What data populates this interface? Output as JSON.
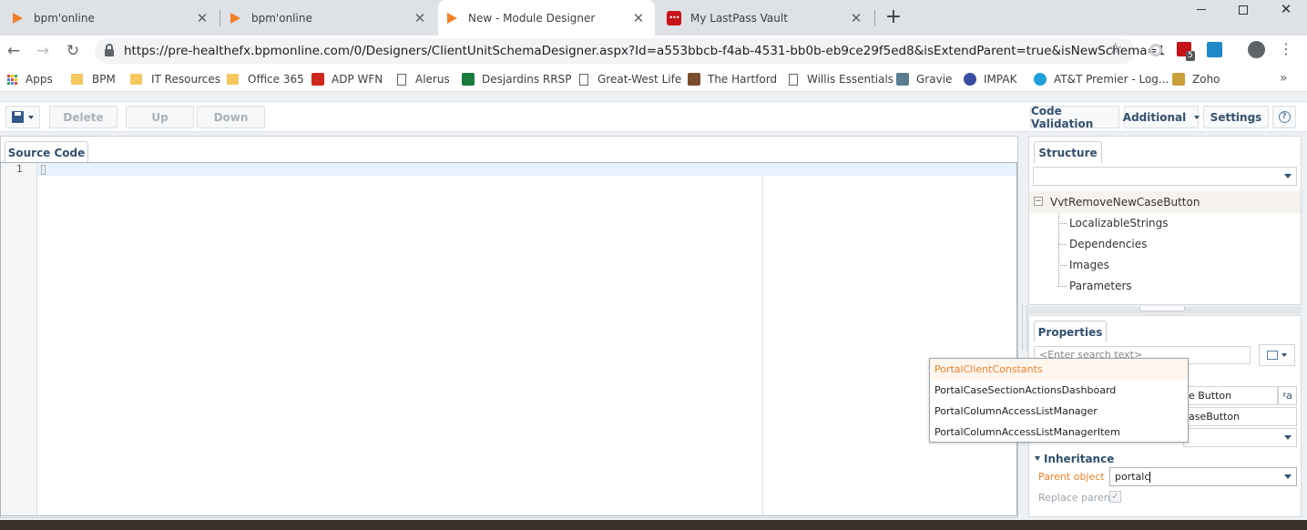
{
  "browser": {
    "tabs": [
      {
        "title": "bpm'online",
        "close": "✕"
      },
      {
        "title": "bpm'online",
        "close": "✕"
      },
      {
        "title": "New - Module Designer",
        "close": "✕"
      },
      {
        "title": "My LastPass Vault",
        "close": "✕"
      }
    ],
    "new_tab": "+",
    "lastpass_icon_text": "•••",
    "url": "https://pre-healthefx.bpmonline.com/0/Designers/ClientUnitSchemaDesigner.aspx?Id=a553bbcb-f4ab-4531-bb0b-eb9ce29f5ed8&isExtendParent=true&isNewSchema=1",
    "extension_badge": "5",
    "bookmarks": [
      "Apps",
      "BPM",
      "IT Resources",
      "Office 365",
      "ADP WFN",
      "Alerus",
      "Desjardins RRSP",
      "Great-West Life",
      "The Hartford",
      "Willis Essentials",
      "Gravie",
      "IMPAK",
      "AT&T Premier - Log...",
      "Zoho"
    ],
    "more_bookmarks": "»",
    "accent_color": "#f07f2a"
  },
  "toolbar": {
    "delete_label": "Delete",
    "up_label": "Up",
    "down_label": "Down",
    "code_validation_label": "Code Validation",
    "additional_label": "Additional",
    "settings_label": "Settings",
    "help_label": "?"
  },
  "editor": {
    "tab_label": "Source Code",
    "line_number": "1"
  },
  "structure": {
    "tab_label": "Structure",
    "root": "VvtRemoveNewCaseButton",
    "expander": "−",
    "children": [
      "LocalizableStrings",
      "Dependencies",
      "Images",
      "Parameters"
    ]
  },
  "properties": {
    "tab_label": "Properties",
    "search_placeholder": "<Enter search text>",
    "caption_value": "e Button",
    "caption_lang_icon": "ᵡa",
    "name_value": "aseButton",
    "inheritance_label": "Inheritance",
    "parent_object_label": "Parent object",
    "parent_object_value": "portalc",
    "replace_parent_label": "Replace parent",
    "label_color": "#f07f2a"
  },
  "autocomplete": {
    "items": [
      "PortalClientConstants",
      "PortalCaseSectionActionsDashboard",
      "PortalColumnAccessListManager",
      "PortalColumnAccessListManagerItem"
    ]
  }
}
